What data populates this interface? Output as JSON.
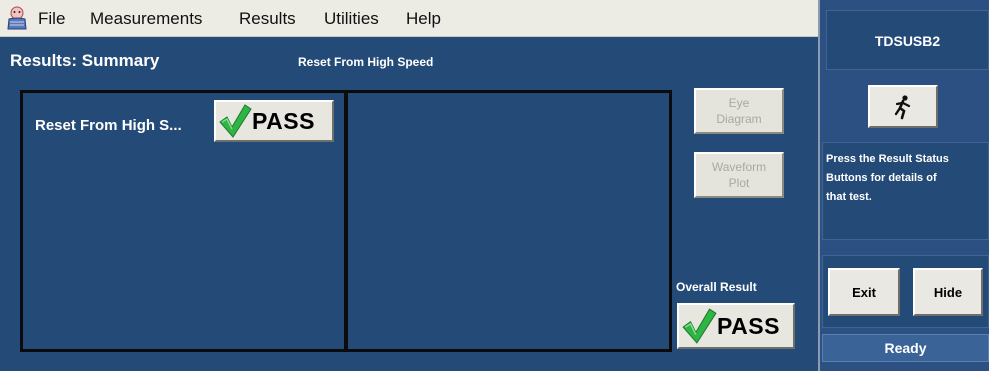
{
  "menu": {
    "items": [
      {
        "label": "File"
      },
      {
        "label": "Measurements"
      },
      {
        "label": "Results"
      },
      {
        "label": "Utilities"
      },
      {
        "label": "Help"
      }
    ]
  },
  "results": {
    "title": "Results: Summary",
    "subtitle": "Reset From High Speed",
    "test_label": "Reset From High S...",
    "test_status": "PASS"
  },
  "side_buttons": {
    "eye_line1": "Eye",
    "eye_line2": "Diagram",
    "waveform_line1": "Waveform",
    "waveform_line2": "Plot"
  },
  "overall": {
    "label": "Overall Result",
    "status": "PASS"
  },
  "right_panel": {
    "device": "TDSUSB2",
    "help_text": "Press the Result Status\nButtons for details of\nthat test.",
    "exit_label": "Exit",
    "hide_label": "Hide",
    "status": "Ready"
  },
  "icons": {
    "app": "app-logo-icon",
    "run": "running-man-icon",
    "check": "green-check-icon"
  },
  "colors": {
    "panel_bg": "#244a77",
    "menu_bg": "#ecebe4",
    "check_green": "#2fb544"
  }
}
